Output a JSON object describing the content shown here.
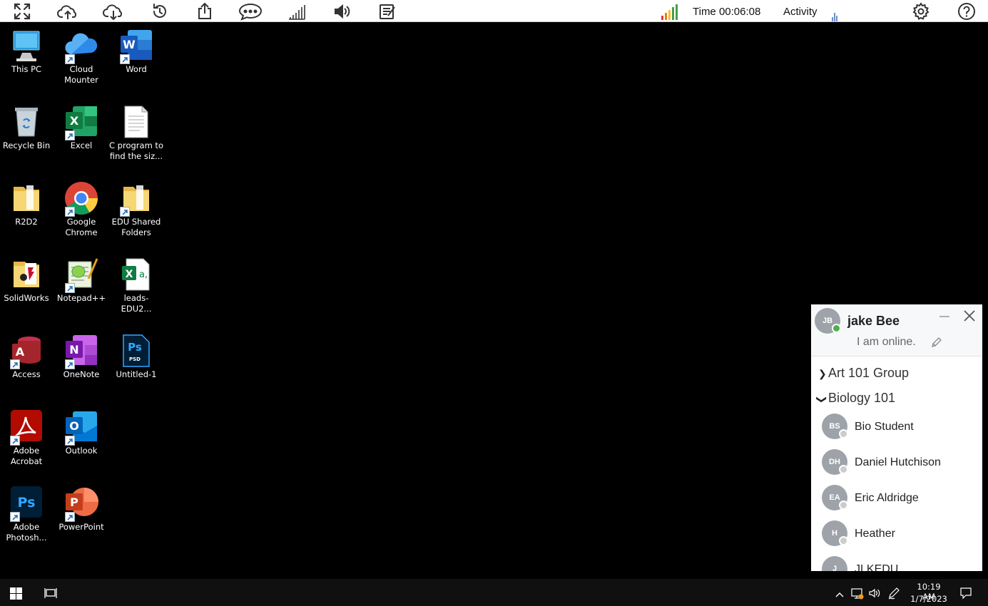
{
  "toolbar": {
    "icons": [
      "fullscreen-icon",
      "cloud-upload-icon",
      "cloud-download-icon",
      "restore-icon",
      "share-icon",
      "chat-icon",
      "signal-bars-icon",
      "volume-icon",
      "notes-icon"
    ],
    "time_label": "Time 00:06:08",
    "activity_label": "Activity",
    "settings_icon": "gear-icon",
    "help_icon": "help-icon"
  },
  "desktop": {
    "icons": [
      {
        "label": "This PC",
        "icon": "computer-icon"
      },
      {
        "label": "Cloud Mounter",
        "icon": "cloud-icon"
      },
      {
        "label": "Word",
        "icon": "word-icon"
      },
      {
        "label": "Recycle Bin",
        "icon": "recycle-bin-icon"
      },
      {
        "label": "Excel",
        "icon": "excel-icon"
      },
      {
        "label": "C program to find the siz...",
        "icon": "document-icon"
      },
      {
        "label": "R2D2",
        "icon": "folder-icon"
      },
      {
        "label": "Google Chrome",
        "icon": "chrome-icon"
      },
      {
        "label": "EDU Shared Folders",
        "icon": "folder-icon"
      },
      {
        "label": "SolidWorks",
        "icon": "solidworks-icon"
      },
      {
        "label": "Notepad++",
        "icon": "notepadpp-icon"
      },
      {
        "label": "leads-EDU2...",
        "icon": "excel-csv-icon"
      },
      {
        "label": "Access",
        "icon": "access-icon"
      },
      {
        "label": "OneNote",
        "icon": "onenote-icon"
      },
      {
        "label": "Untitled-1",
        "icon": "psd-file-icon"
      },
      {
        "label": "Adobe Acrobat",
        "icon": "acrobat-icon"
      },
      {
        "label": "Outlook",
        "icon": "outlook-icon"
      },
      {
        "label": "Adobe Photosh...",
        "icon": "photoshop-icon"
      },
      {
        "label": "PowerPoint",
        "icon": "powerpoint-icon"
      }
    ]
  },
  "chat": {
    "me": {
      "initials": "JB",
      "name": "jake Bee",
      "status": "I am online.",
      "presence_color": "#4caf50"
    },
    "groups": [
      {
        "label": "Art 101 Group",
        "expanded": false
      },
      {
        "label": "Biology 101",
        "expanded": true
      }
    ],
    "members": [
      {
        "initials": "BS",
        "name": "Bio Student"
      },
      {
        "initials": "DH",
        "name": "Daniel Hutchison"
      },
      {
        "initials": "EA",
        "name": "Eric Aldridge"
      },
      {
        "initials": "H",
        "name": "Heather"
      },
      {
        "initials": "J",
        "name": "JLKEDU"
      }
    ]
  },
  "taskbar": {
    "clock_time": "10:19 AM",
    "clock_date": "1/7/2023"
  },
  "colors": {
    "toolbar_bg": "#ffffff",
    "desktop_bg": "#000000",
    "taskbar_bg": "#101010",
    "signal_bars": [
      "#e53935",
      "#f57c00",
      "#fbc02d",
      "#43a047",
      "#43a047"
    ]
  }
}
